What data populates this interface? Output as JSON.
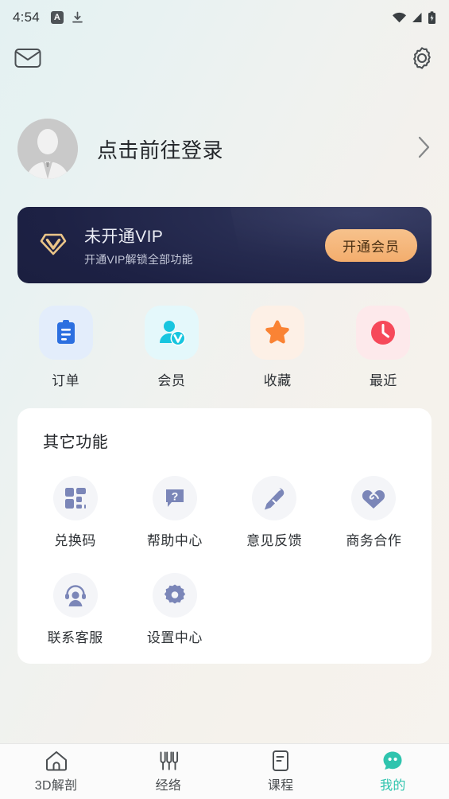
{
  "statusbar": {
    "time": "4:54",
    "badge_letter": "A",
    "icons": [
      "app-badge-icon",
      "download-icon",
      "wifi-icon",
      "cellular-signal-icon",
      "battery-icon"
    ]
  },
  "appbar": {
    "mail_icon": "mail-envelope-icon",
    "settings_icon": "gear-icon"
  },
  "profile": {
    "name": "点击前往登录",
    "avatar_icon": "default-user-avatar",
    "chevron_icon": "chevron-right-icon"
  },
  "vip": {
    "icon": "vip-diamond-icon",
    "title": "未开通VIP",
    "subtitle": "开通VIP解锁全部功能",
    "button_label": "开通会员",
    "bg_color": "#1d2144",
    "button_color": "#f3ad6d"
  },
  "quick_actions": [
    {
      "label": "订单",
      "icon": "clipboard-order-icon",
      "icon_color": "#2c6fe0",
      "bg_color": "#e3edfb"
    },
    {
      "label": "会员",
      "icon": "member-v-badge-icon",
      "icon_color": "#19c8e0",
      "bg_color": "#e3f8fb"
    },
    {
      "label": "收藏",
      "icon": "star-favorite-icon",
      "icon_color": "#fa8334",
      "bg_color": "#fdf0e6"
    },
    {
      "label": "最近",
      "icon": "clock-recent-icon",
      "icon_color": "#f6495a",
      "bg_color": "#fde9eb"
    }
  ],
  "other_functions": {
    "title": "其它功能",
    "items": [
      {
        "label": "兑换码",
        "icon": "grid-blocks-icon"
      },
      {
        "label": "帮助中心",
        "icon": "question-bubble-icon"
      },
      {
        "label": "意见反馈",
        "icon": "pencil-edit-icon"
      },
      {
        "label": "商务合作",
        "icon": "handshake-heart-icon"
      },
      {
        "label": "联系客服",
        "icon": "headset-support-icon"
      },
      {
        "label": "设置中心",
        "icon": "gear-settings-icon"
      }
    ],
    "icon_color": "#7b86b8"
  },
  "tabbar": {
    "active_color": "#2fc4ae",
    "items": [
      {
        "label": "3D解剖",
        "icon": "home-icon",
        "active": false
      },
      {
        "label": "经络",
        "icon": "needles-icon",
        "active": false
      },
      {
        "label": "课程",
        "icon": "document-icon",
        "active": false
      },
      {
        "label": "我的",
        "icon": "profile-blob-icon",
        "active": true
      }
    ]
  }
}
